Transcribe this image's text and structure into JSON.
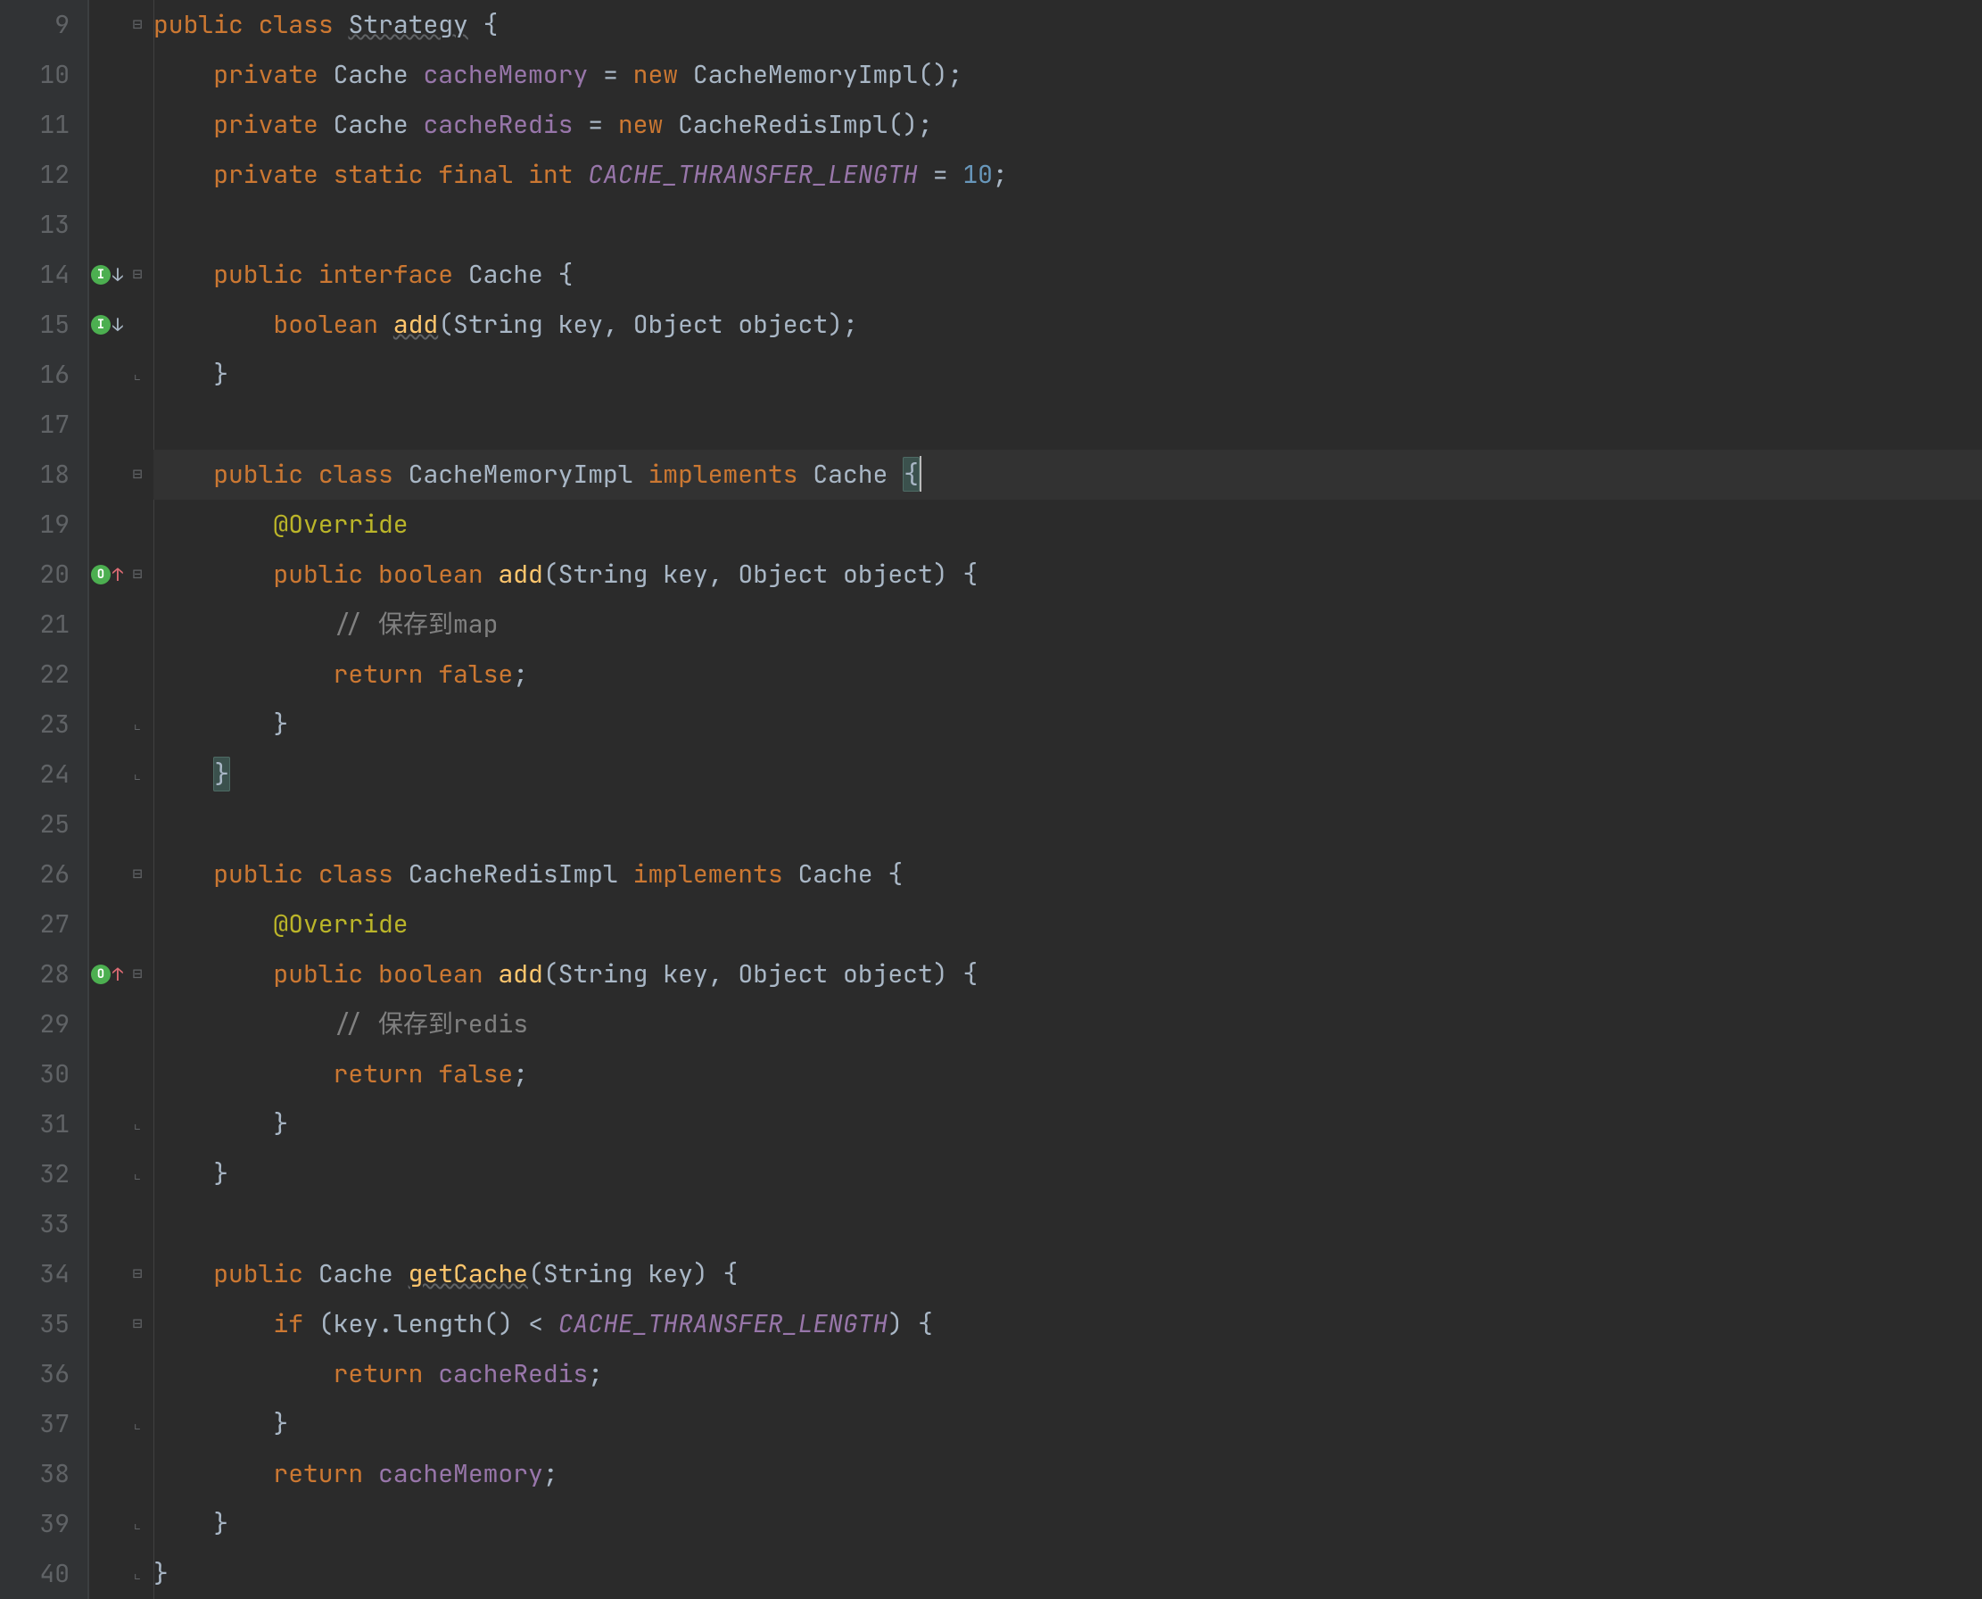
{
  "lineStart": 9,
  "lineEnd": 40,
  "gutterIcons": {
    "14": {
      "type": "impl-down"
    },
    "15": {
      "type": "impl-down"
    },
    "20": {
      "type": "override-up"
    },
    "28": {
      "type": "override-up"
    }
  },
  "foldMarkers": {
    "9": "open",
    "14": "open",
    "16": "close",
    "18": "open",
    "20": "open",
    "23": "close",
    "24": "close",
    "26": "open",
    "28": "open",
    "31": "close",
    "32": "close",
    "34": "open",
    "35": "open",
    "37": "close",
    "39": "close",
    "40": "close"
  },
  "currentLine": 18,
  "tokens": {
    "indent1": "    ",
    "indent2": "        ",
    "indent3": "            ",
    "indent4": "                ",
    "public": "public",
    "private": "private",
    "static": "static",
    "final": "final",
    "class": "class",
    "interface": "interface",
    "implements": "implements",
    "new": "new",
    "int": "int",
    "boolean": "boolean",
    "return": "return",
    "if": "if",
    "false": "false",
    "Strategy": "Strategy",
    "Cache": "Cache",
    "CacheMemoryImpl": "CacheMemoryImpl",
    "CacheRedisImpl": "CacheRedisImpl",
    "String": "String",
    "Object": "Object",
    "Override": "@Override",
    "cacheMemory": "cacheMemory",
    "cacheRedis": "cacheRedis",
    "CACHE_THRANSFER_LENGTH": "CACHE_THRANSFER_LENGTH",
    "ten": "10",
    "add": "add",
    "getCache": "getCache",
    "key": "key",
    "object": "object",
    "length": "length",
    "cmtMap": "// 保存到map",
    "cmtRedis": "// 保存到redis",
    "eq": " = ",
    "opSemi": ";",
    "opParenO": "(",
    "opParenC": ")",
    "opBraceO": "{",
    "opBraceC": "}",
    "opComma": ", ",
    "opDot": ".",
    "opLt": " < ",
    "sp": " "
  }
}
